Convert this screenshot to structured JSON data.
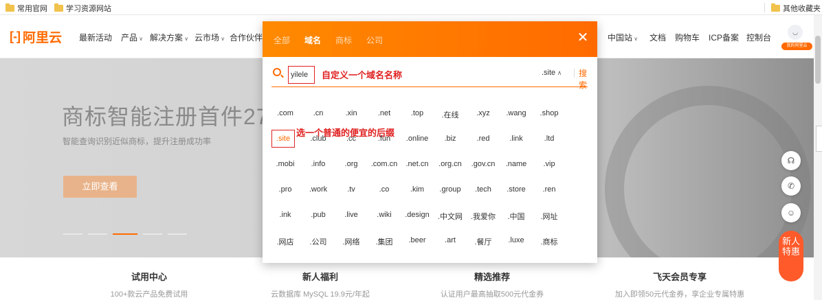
{
  "bookmarks": {
    "items": [
      "常用官网",
      "学习资源网站"
    ],
    "other": "其他收藏夹"
  },
  "nav": {
    "logo_text": "阿里云",
    "logo_mark": "[-]",
    "items": [
      {
        "label": "最新活动",
        "caret": false
      },
      {
        "label": "产品",
        "caret": true
      },
      {
        "label": "解决方案",
        "caret": true
      },
      {
        "label": "云市场",
        "caret": true
      },
      {
        "label": "合作伙伴",
        "caret": true
      }
    ],
    "right_items": [
      {
        "label": "中国站",
        "caret": true
      },
      {
        "label": "文档",
        "caret": false
      },
      {
        "label": "购物车",
        "caret": false
      },
      {
        "label": "ICP备案",
        "caret": false
      },
      {
        "label": "控制台",
        "caret": false
      }
    ],
    "avatar_badge": "我的阿里云"
  },
  "hero": {
    "title": "商标智能注册首件27",
    "subtitle": "智能查询识别近似商标，提升注册成功率",
    "button": "立即查看"
  },
  "overlay": {
    "tabs": [
      "全部",
      "域名",
      "商标",
      "公司"
    ],
    "active_tab": 1,
    "close": "✕",
    "search": {
      "value": "yilele",
      "suffix": ".site",
      "button": "搜索"
    },
    "annotation_name": "自定义一个域名名称",
    "annotation_suffix": "选一个普通的便宜的后缀",
    "selected_tld": ".site",
    "tld_rows": [
      [
        ".com",
        ".cn",
        ".xin",
        ".net",
        ".top",
        ".在线",
        ".xyz",
        ".wang",
        ".shop"
      ],
      [
        ".site",
        ".club",
        ".cc",
        ".fun",
        ".online",
        ".biz",
        ".red",
        ".link",
        ".ltd"
      ],
      [
        ".mobi",
        ".info",
        ".org",
        ".com.cn",
        ".net.cn",
        ".org.cn",
        ".gov.cn",
        ".name",
        ".vip"
      ],
      [
        ".pro",
        ".work",
        ".tv",
        ".co",
        ".kim",
        ".group",
        ".tech",
        ".store",
        ".ren"
      ],
      [
        ".ink",
        ".pub",
        ".live",
        ".wiki",
        ".design",
        ".中文网",
        ".我爱你",
        ".中国",
        ".网址"
      ],
      [
        ".网店",
        ".公司",
        ".网络",
        ".集团",
        ".beer",
        ".art",
        ".餐厅",
        ".luxe",
        ".商标"
      ]
    ]
  },
  "tools": {
    "newbie": "新人特惠"
  },
  "promos": [
    {
      "title": "试用中心",
      "desc": "100+款云产品免费试用"
    },
    {
      "title": "新人福利",
      "desc": "云数据库 MySQL 19.9元/年起"
    },
    {
      "title": "精选推荐",
      "desc": "认证用户最高抽取500元代金券"
    },
    {
      "title": "飞天会员专享",
      "desc": "加入即领50元代金券，享企业专属特惠"
    }
  ]
}
